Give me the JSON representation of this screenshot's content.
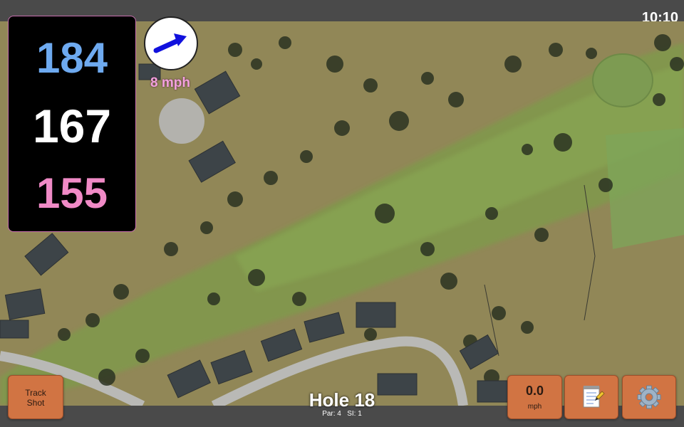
{
  "status": {
    "time": "10:10"
  },
  "yardages": {
    "back": "184",
    "middle": "167",
    "front": "155"
  },
  "wind": {
    "speed": "8 mph"
  },
  "buttons": {
    "track_line1": "Track",
    "track_line2": "Shot",
    "speed_value": "0.0",
    "speed_unit": "mph",
    "notes_icon": "notepad-icon",
    "settings_icon": "gear-icon"
  },
  "hole": {
    "title": "Hole 18",
    "par": "Par: 4",
    "si": "SI: 1"
  },
  "colors": {
    "back_yardage": "#6eaaf0",
    "front_yardage": "#f08ac6",
    "button": "#d17443"
  }
}
